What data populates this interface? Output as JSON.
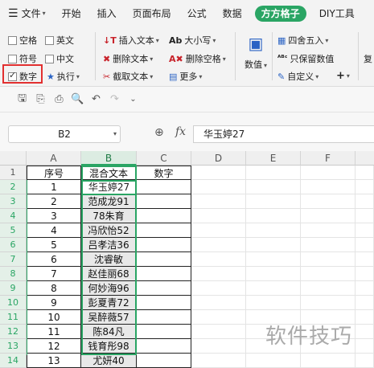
{
  "tabs": {
    "menu_label": "文件",
    "items": [
      "开始",
      "插入",
      "页面布局",
      "公式",
      "数据",
      "方方格子",
      "DIY工具"
    ],
    "active": "方方格子"
  },
  "ribbon": {
    "checkbox_space": "空格",
    "checkbox_english": "英文",
    "checkbox_symbol": "符号",
    "checkbox_chinese": "中文",
    "checkbox_number": "数字",
    "execute": "执行",
    "insert_text": "插入文本",
    "delete_text": "删除文本",
    "cut_text": "截取文本",
    "case": "大小写",
    "delete_space": "删除空格",
    "more": "更多",
    "numeric": "数值",
    "round": "四舍五入",
    "keep_number": "只保留数值",
    "custom": "自定义",
    "plus": "+",
    "cut_partial": "复"
  },
  "formula_bar": {
    "cell_ref": "B2",
    "fx_label": "fx",
    "value": "华玉婷27"
  },
  "columns": [
    "A",
    "B",
    "C",
    "D",
    "E",
    "F"
  ],
  "row_numbers": [
    "1",
    "2",
    "3",
    "4",
    "5",
    "6",
    "7",
    "8",
    "9",
    "10",
    "11",
    "12",
    "13",
    "14"
  ],
  "table": {
    "headers": [
      "序号",
      "混合文本",
      "数字"
    ],
    "rows": [
      [
        "1",
        "华玉婷27",
        ""
      ],
      [
        "2",
        "范成龙91",
        ""
      ],
      [
        "3",
        "78朱育",
        ""
      ],
      [
        "4",
        "冯欣怡52",
        ""
      ],
      [
        "5",
        "吕孝洁36",
        ""
      ],
      [
        "6",
        "沈睿敏",
        ""
      ],
      [
        "7",
        "赵佳丽68",
        ""
      ],
      [
        "8",
        "何妙海96",
        ""
      ],
      [
        "9",
        "彭夏青72",
        ""
      ],
      [
        "10",
        "吴醉薇57",
        ""
      ],
      [
        "11",
        "陈84凡",
        ""
      ],
      [
        "12",
        "钱育彤98",
        ""
      ],
      [
        "13",
        "尤妍40",
        ""
      ]
    ]
  },
  "watermark": "软件技巧"
}
